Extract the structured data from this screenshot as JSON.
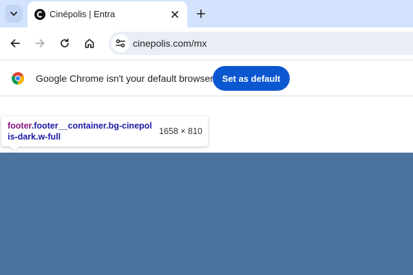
{
  "browser": {
    "tab": {
      "title": "Cinépolis | Entra"
    },
    "address_bar": {
      "url": "cinepolis.com/mx"
    }
  },
  "infobar": {
    "message": "Google Chrome isn't your default browser",
    "button_label": "Set as default"
  },
  "inspect_tooltip": {
    "tag": "footer",
    "classes": ".footer__container.bg-cinepolis-dark.w-full",
    "size": "1658 × 810"
  },
  "colors": {
    "tabstrip": "#d3e3fd",
    "accent_button": "#0b57d0",
    "footer_background": "#4a749f"
  }
}
